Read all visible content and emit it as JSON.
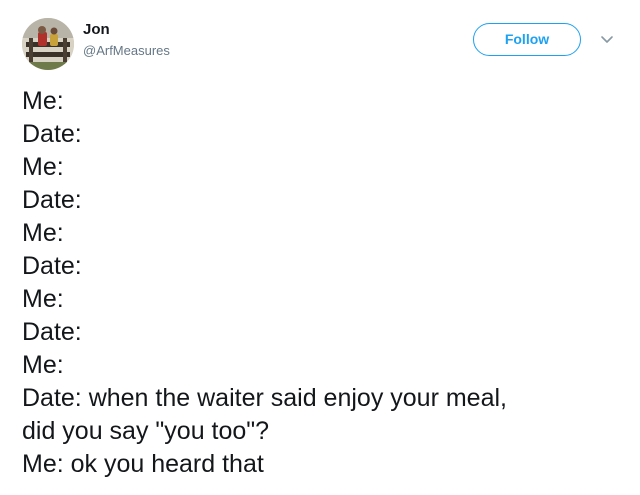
{
  "tweet": {
    "author": {
      "display_name": "Jon",
      "handle": "@ArfMeasures",
      "avatar_icon": "profile-photo-icon"
    },
    "follow_label": "Follow",
    "menu_icon": "chevron-down-icon",
    "lines": [
      "Me:",
      "Date:",
      "Me:",
      "Date:",
      "Me:",
      "Date:",
      "Me:",
      "Date:",
      "Me:",
      "Date: when the waiter said enjoy your meal,",
      "did you say \"you too\"?",
      "Me: ok you heard that"
    ]
  },
  "colors": {
    "accent": "#1da1f2",
    "text_primary": "#14171a",
    "text_secondary": "#657786",
    "background": "#ffffff"
  }
}
